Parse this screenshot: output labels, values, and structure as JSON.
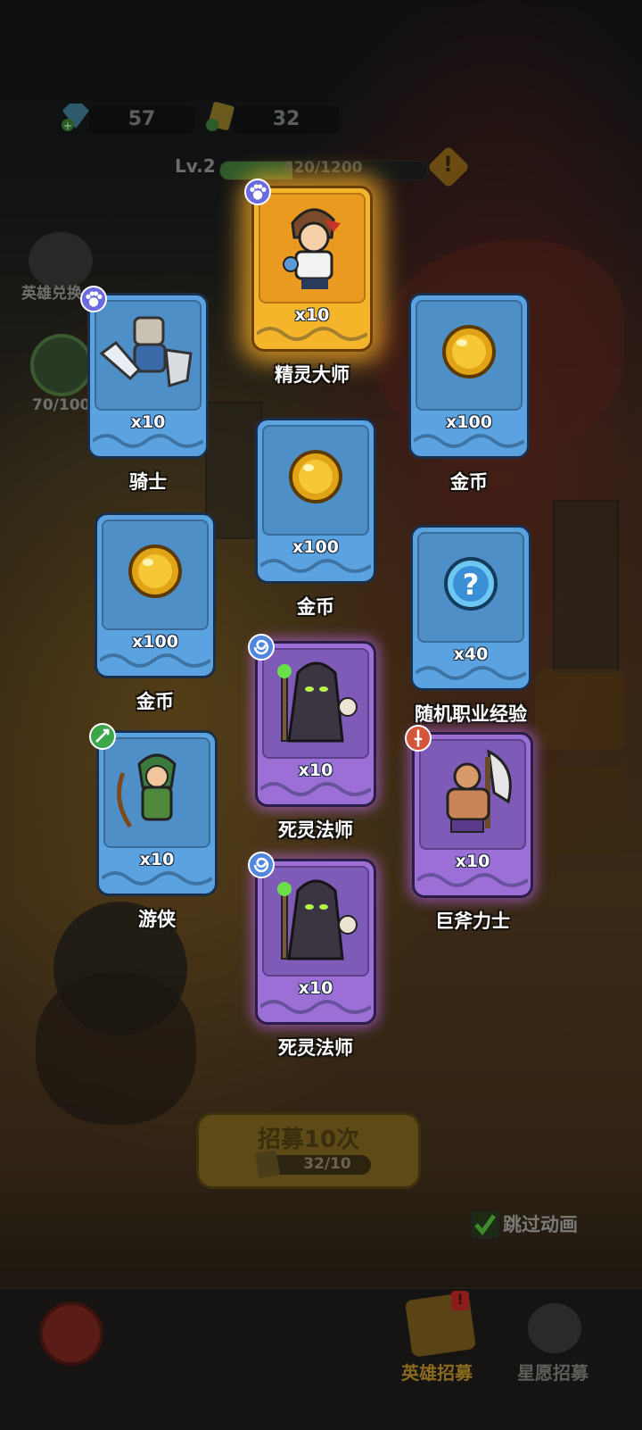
{
  "hud": {
    "gems": "57",
    "tickets": "32",
    "level_label": "Lv.2",
    "xp_text": "420/1200",
    "xp_progress": 0.35
  },
  "side": {
    "hero_exchange_label": "英雄兑换",
    "star_progress": "70/100"
  },
  "cards": [
    {
      "name": "精灵大师",
      "qty": "x10",
      "rarity": "gold",
      "icon": "hero-trainer-icon",
      "badge": "paw-badge"
    },
    {
      "name": "骑士",
      "qty": "x10",
      "rarity": "blue",
      "icon": "knight-icon",
      "badge": "paw-badge"
    },
    {
      "name": "金币",
      "qty": "x100",
      "rarity": "blue",
      "icon": "gold-coin-icon"
    },
    {
      "name": "金币",
      "qty": "x100",
      "rarity": "blue",
      "icon": "gold-coin-icon"
    },
    {
      "name": "金币",
      "qty": "x100",
      "rarity": "blue",
      "icon": "gold-coin-icon"
    },
    {
      "name": "随机职业经验",
      "qty": "x40",
      "rarity": "blue",
      "icon": "question-orb-icon"
    },
    {
      "name": "死灵法师",
      "qty": "x10",
      "rarity": "purple",
      "icon": "necromancer-icon",
      "badge": "swirl-badge"
    },
    {
      "name": "游侠",
      "qty": "x10",
      "rarity": "blue",
      "icon": "ranger-icon",
      "badge": "bow-badge"
    },
    {
      "name": "巨斧力士",
      "qty": "x10",
      "rarity": "purple",
      "icon": "axe-warrior-icon",
      "badge": "sword-badge"
    },
    {
      "name": "死灵法师",
      "qty": "x10",
      "rarity": "purple",
      "icon": "necromancer-icon",
      "badge": "swirl-badge"
    }
  ],
  "recruit": {
    "button_label": "招募10次",
    "count": "32/10"
  },
  "skip": {
    "label": "跳过动画",
    "checked": true
  },
  "tabs": {
    "hero_recruit": "英雄招募",
    "wish_recruit": "星愿招募"
  },
  "colors": {
    "gold_glow": "#ffb028",
    "purple_glow": "#c46eff",
    "card_blue": "#5aa3e0",
    "active_tab": "#8a6a1c"
  }
}
